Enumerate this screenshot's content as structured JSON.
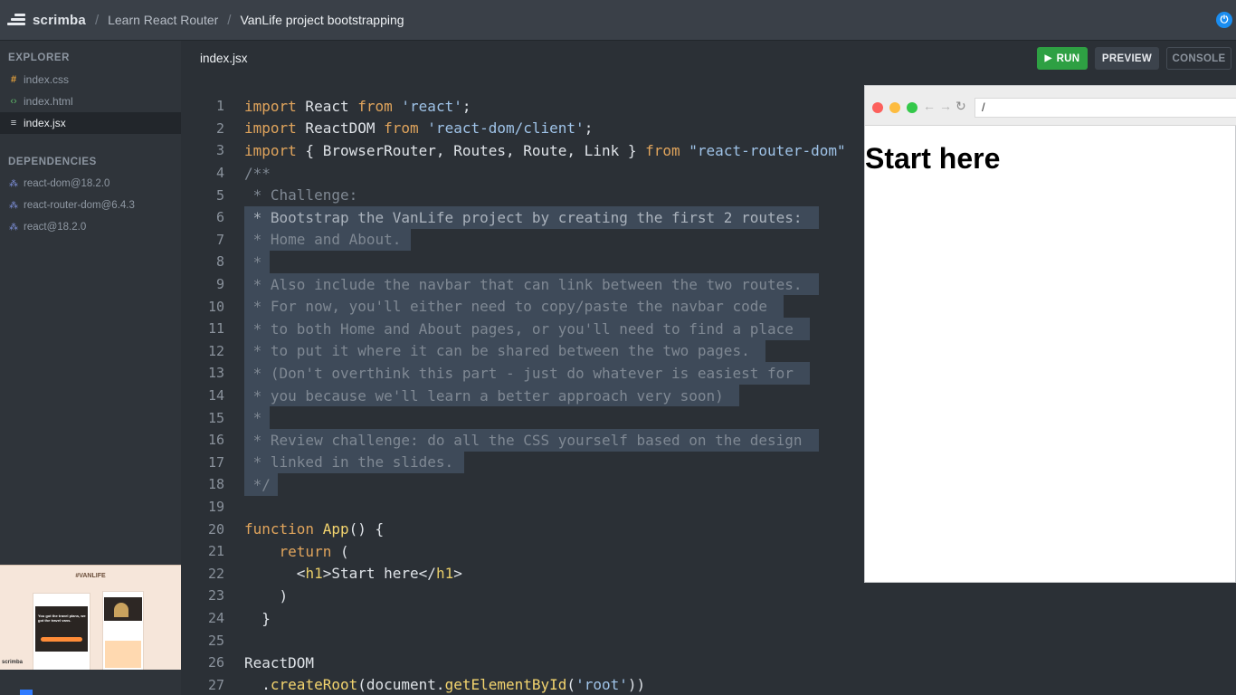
{
  "header": {
    "logo_text": "scrimba",
    "breadcrumbs": [
      "Learn React Router",
      "VanLife project bootstrapping"
    ]
  },
  "sidebar": {
    "explorer_title": "EXPLORER",
    "files": [
      {
        "name": "index.css",
        "icon": "hash-icon"
      },
      {
        "name": "index.html",
        "icon": "code-icon"
      },
      {
        "name": "index.jsx",
        "icon": "file-icon"
      }
    ],
    "dependencies_title": "DEPENDENCIES",
    "dependencies": [
      "react-dom@18.2.0",
      "react-router-dom@6.4.3",
      "react@18.2.0"
    ],
    "thumbnail": {
      "title": "#VANLIFE",
      "headline": "You got the travel plans, we got the travel vans.",
      "footer": "scrimba"
    }
  },
  "editor": {
    "active_file": "index.jsx",
    "buttons": {
      "run": "RUN",
      "preview": "PREVIEW",
      "console": "CONSOLE"
    },
    "lines": [
      {
        "n": "1",
        "text": "import React from 'react';"
      },
      {
        "n": "2",
        "text": "import ReactDOM from 'react-dom/client';"
      },
      {
        "n": "3",
        "text": "import { BrowserRouter, Routes, Route, Link } from \"react-router-dom\""
      },
      {
        "n": "4",
        "text": "/**"
      },
      {
        "n": "5",
        "text": " * Challenge:"
      },
      {
        "n": "6",
        "text": " * Bootstrap the VanLife project by creating the first 2 routes:"
      },
      {
        "n": "7",
        "text": " * Home and About."
      },
      {
        "n": "8",
        "text": " *"
      },
      {
        "n": "9",
        "text": " * Also include the navbar that can link between the two routes."
      },
      {
        "n": "10",
        "text": " * For now, you'll either need to copy/paste the navbar code"
      },
      {
        "n": "11",
        "text": " * to both Home and About pages, or you'll need to find a place"
      },
      {
        "n": "12",
        "text": " * to put it where it can be shared between the two pages."
      },
      {
        "n": "13",
        "text": " * (Don't overthink this part - just do whatever is easiest for"
      },
      {
        "n": "14",
        "text": " * you because we'll learn a better approach very soon)"
      },
      {
        "n": "15",
        "text": " *"
      },
      {
        "n": "16",
        "text": " * Review challenge: do all the CSS yourself based on the design"
      },
      {
        "n": "17",
        "text": " * linked in the slides."
      },
      {
        "n": "18",
        "text": " */"
      },
      {
        "n": "19",
        "text": ""
      },
      {
        "n": "20",
        "text": "function App() {"
      },
      {
        "n": "21",
        "text": "    return ("
      },
      {
        "n": "22",
        "text": "      <h1>Start here</h1>"
      },
      {
        "n": "23",
        "text": "    )"
      },
      {
        "n": "24",
        "text": "  }"
      },
      {
        "n": "25",
        "text": ""
      },
      {
        "n": "26",
        "text": "ReactDOM"
      },
      {
        "n": "27",
        "text": "  .createRoot(document.getElementById('root'))"
      }
    ]
  },
  "preview": {
    "url": "/",
    "heading": "Start here"
  },
  "colors": {
    "run_button": "#2ea043",
    "selection": "#3e4a59",
    "keyword": "#e0a45c",
    "string": "#9fc3e8",
    "comment": "#7f8893",
    "power_button": "#1a8df0"
  }
}
